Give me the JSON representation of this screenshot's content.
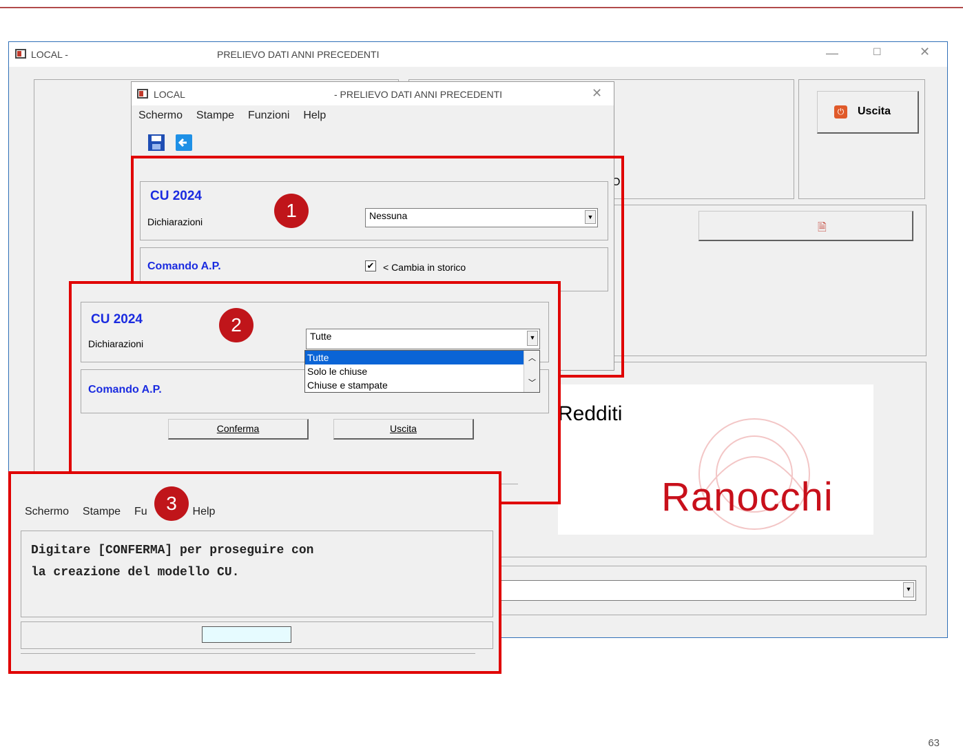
{
  "main_window": {
    "app": "LOCAL -",
    "title": "PRELIEVO DATI ANNI PRECEDENTI",
    "exit_button": "Uscita",
    "brand_partial": "Redditi",
    "brand_logo": "Ranocchi",
    "partial_text": "O"
  },
  "dialog1": {
    "app": "LOCAL",
    "title": "- PRELIEVO DATI ANNI PRECEDENTI",
    "menu": [
      "Schermo",
      "Stampe",
      "Funzioni",
      "Help"
    ],
    "section_title": "CU 2024",
    "field_label": "Dichiarazioni",
    "select_value": "Nessuna",
    "command_label": "Comando A.P.",
    "checkbox_label": "< Cambia in storico",
    "checkbox_checked": true
  },
  "dialog2": {
    "section_title": "CU 2024",
    "field_label": "Dichiarazioni",
    "select_value": "Tutte",
    "options": [
      "Tutte",
      "Solo le chiuse",
      "Chiuse e stampate"
    ],
    "command_label": "Comando A.P.",
    "confirm_button": "Conferma",
    "exit_button": "Uscita"
  },
  "dialog3": {
    "menu": [
      "Schermo",
      "Stampe",
      "Fu",
      "Help"
    ],
    "message_line1": "Digitare [CONFERMA] per proseguire con",
    "message_line2": "la creazione del modello CU."
  },
  "badges": [
    "1",
    "2",
    "3"
  ],
  "page_number": "63",
  "colors": {
    "highlight": "#e00000",
    "badge": "#c0151a",
    "section_blue": "#1a2be0",
    "selection": "#0a64d6"
  }
}
